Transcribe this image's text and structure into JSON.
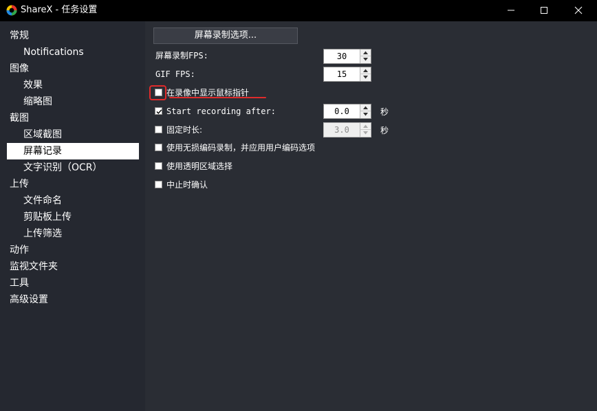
{
  "window": {
    "title": "ShareX - 任务设置",
    "icon": "sharex-logo-icon",
    "controls": [
      "minimize-icon",
      "maximize-icon",
      "close-icon"
    ]
  },
  "sidebar": {
    "items": [
      {
        "label": "常规",
        "level": 0
      },
      {
        "label": "Notifications",
        "level": 1
      },
      {
        "label": "图像",
        "level": 0
      },
      {
        "label": "效果",
        "level": 1
      },
      {
        "label": "缩略图",
        "level": 1
      },
      {
        "label": "截图",
        "level": 0
      },
      {
        "label": "区域截图",
        "level": 1
      },
      {
        "label": "屏幕记录",
        "level": 1,
        "selected": true
      },
      {
        "label": "文字识别（OCR）",
        "level": 1
      },
      {
        "label": "上传",
        "level": 0
      },
      {
        "label": "文件命名",
        "level": 1
      },
      {
        "label": "剪贴板上传",
        "level": 1
      },
      {
        "label": "上传筛选",
        "level": 1
      },
      {
        "label": "动作",
        "level": 0
      },
      {
        "label": "监视文件夹",
        "level": 0
      },
      {
        "label": "工具",
        "level": 0
      },
      {
        "label": "高级设置",
        "level": 0
      }
    ]
  },
  "content": {
    "options_button": "屏幕录制选项...",
    "fps": {
      "label": "屏幕录制FPS:",
      "value": "30"
    },
    "gif_fps": {
      "label": "GIF FPS:",
      "value": "15"
    },
    "show_cursor": {
      "label": "在录像中显示鼠标指针",
      "checked": false
    },
    "start_after": {
      "label": "Start recording after:",
      "checked": true,
      "value": "0.0",
      "unit": "秒"
    },
    "fixed_duration": {
      "label": "固定时长:",
      "checked": false,
      "value": "3.0",
      "unit": "秒"
    },
    "lossless": {
      "label": "使用无损编码录制，并应用用户编码选项",
      "checked": false
    },
    "transparent_region": {
      "label": "使用透明区域选择",
      "checked": false
    },
    "confirm_abort": {
      "label": "中止时确认",
      "checked": false
    }
  },
  "colors": {
    "titlebar": "#000000",
    "sidebar": "#252830",
    "content": "#2a2d34",
    "selected_item": "#ffffff",
    "annotation": "#e02b2b"
  }
}
